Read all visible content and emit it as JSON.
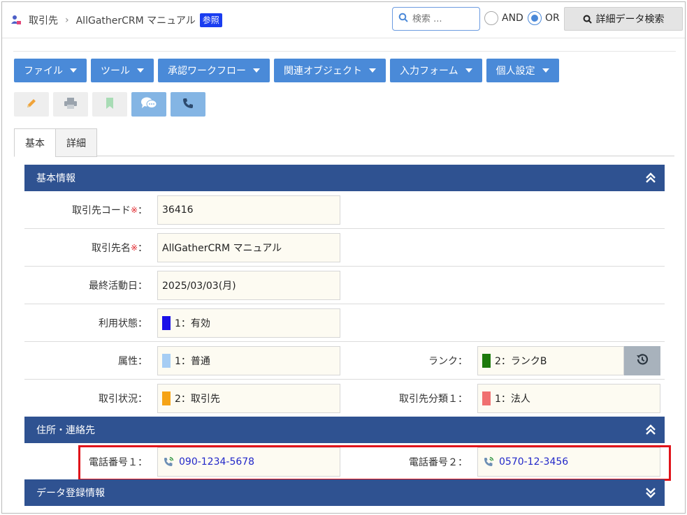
{
  "breadcrumb": {
    "root": "取引先",
    "current": "AllGatherCRM マニュアル",
    "badge": "参照"
  },
  "search": {
    "placeholder": "検索 ...",
    "and_label": "AND",
    "or_label": "OR",
    "selected": "OR",
    "advanced_label": "詳細データ検索"
  },
  "menus": [
    {
      "label": "ファイル"
    },
    {
      "label": "ツール"
    },
    {
      "label": "承認ワークフロー"
    },
    {
      "label": "関連オブジェクト"
    },
    {
      "label": "入力フォーム"
    },
    {
      "label": "個人設定"
    }
  ],
  "tools": [
    "pencil-icon",
    "printer-icon",
    "bookmark-icon",
    "chat-icon",
    "phone-icon"
  ],
  "tabs": [
    {
      "label": "基本",
      "active": true
    },
    {
      "label": "詳細",
      "active": false
    }
  ],
  "sections": {
    "basic": {
      "title": "基本情報"
    },
    "address": {
      "title": "住所・連絡先"
    },
    "registration": {
      "title": "データ登録情報"
    }
  },
  "fields": {
    "code": {
      "label": "取引先コード",
      "required_mark": "※",
      "suffix": "：",
      "value": "36416"
    },
    "name": {
      "label": "取引先名",
      "required_mark": "※",
      "suffix": "：",
      "value": "AllGatherCRM マニュアル"
    },
    "last_activity": {
      "label": "最終活動日：",
      "value": "2025/03/03(月)"
    },
    "status": {
      "label": "利用状態：",
      "value": "1：有効",
      "color": "#1a10e8"
    },
    "attribute": {
      "label": "属性：",
      "value": "1：普通",
      "color": "#a6cdf4"
    },
    "rank": {
      "label": "ランク：",
      "value": "2：ランクB",
      "color": "#1d7a0c"
    },
    "trade_status": {
      "label": "取引状況：",
      "value": "2：取引先",
      "color": "#f5a316"
    },
    "category1": {
      "label": "取引先分類１：",
      "value": "1：法人",
      "color": "#f07070"
    },
    "phone1": {
      "label": "電話番号１：",
      "value": "090-1234-5678"
    },
    "phone2": {
      "label": "電話番号２：",
      "value": "0570-12-3456"
    }
  },
  "colors": {
    "menu": "#4a8ad8",
    "section": "#2f5291",
    "field_bg": "#fdfbf2",
    "highlight": "#e0131a",
    "phone_text": "#2228c9"
  }
}
